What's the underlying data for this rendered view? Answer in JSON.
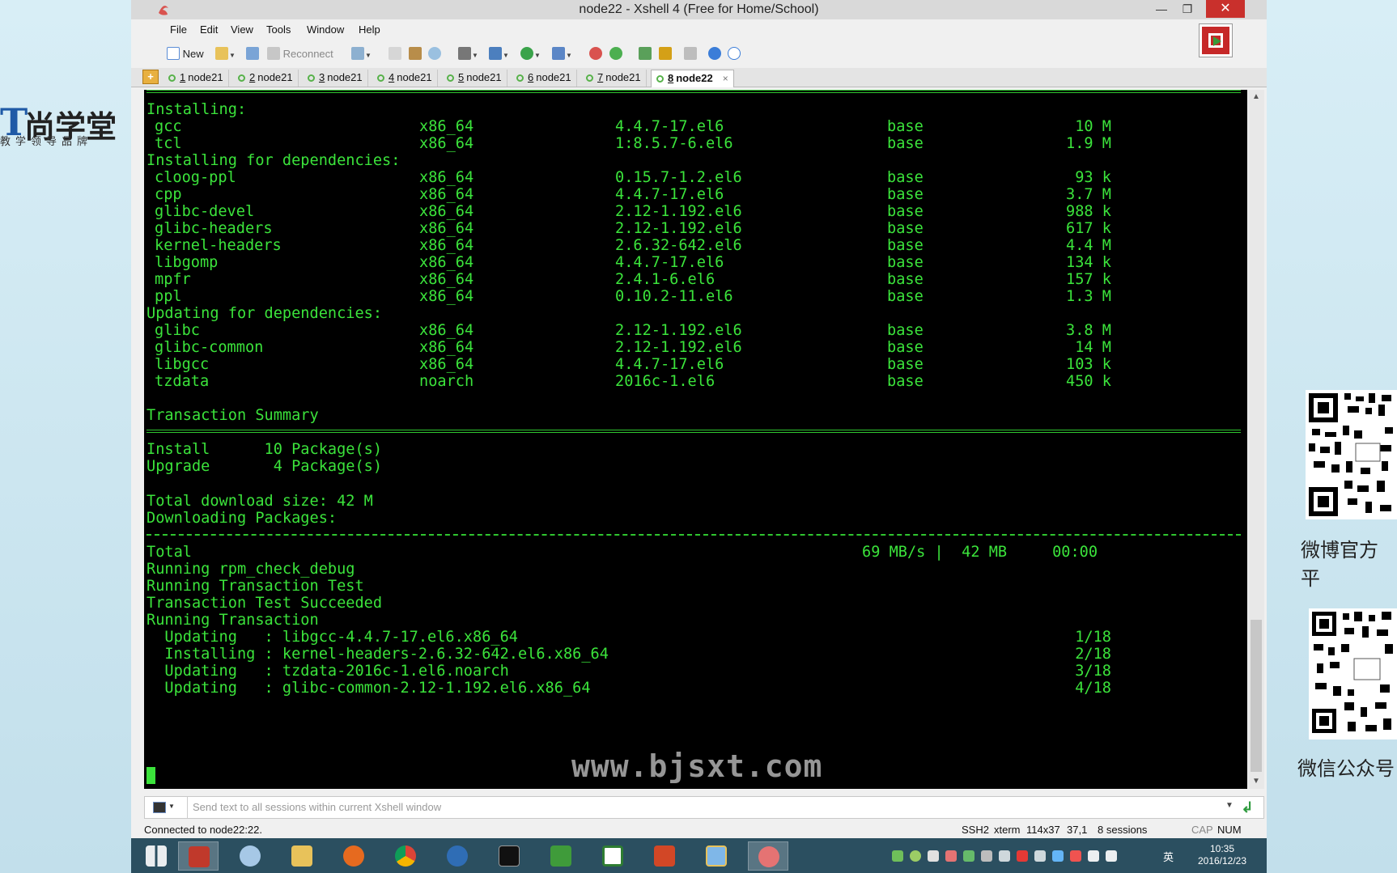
{
  "branding": {
    "logo_name": "尚学堂",
    "logo_slogan": "教学领导品牌",
    "qr_labels": [
      "微博官方平",
      "微信公众号"
    ],
    "watermark": "www.bjsxt.com"
  },
  "window": {
    "title": "node22 - Xshell 4 (Free for Home/School)",
    "controls": {
      "minimize": "—",
      "restore": "❐",
      "close": "✕"
    }
  },
  "menu": [
    "File",
    "Edit",
    "View",
    "Tools",
    "Window",
    "Help"
  ],
  "toolbar": {
    "new_label": "New",
    "reconnect_label": "Reconnect",
    "icons": [
      "new-session-icon",
      "open-folder-icon",
      "link-icon",
      "reconnect-icon",
      "properties-icon",
      "copy-icon",
      "paste-icon",
      "find-icon",
      "print-icon",
      "transfer-icon",
      "globe-icon",
      "keyboard-icon",
      "xftp-icon",
      "xmanager-icon",
      "layout-icon",
      "lock-icon",
      "compose-icon",
      "help-icon",
      "chat-icon"
    ]
  },
  "tabs": [
    {
      "num": "1",
      "label": "node21",
      "active": false
    },
    {
      "num": "2",
      "label": "node21",
      "active": false
    },
    {
      "num": "3",
      "label": "node21",
      "active": false
    },
    {
      "num": "4",
      "label": "node21",
      "active": false
    },
    {
      "num": "5",
      "label": "node21",
      "active": false
    },
    {
      "num": "6",
      "label": "node21",
      "active": false
    },
    {
      "num": "7",
      "label": "node21",
      "active": false
    },
    {
      "num": "8",
      "label": "node22",
      "active": true
    }
  ],
  "tab_add": "+",
  "tab_close": "×",
  "terminal": {
    "headings": {
      "installing": "Installing:",
      "installing_deps": "Installing for dependencies:",
      "updating_deps": "Updating for dependencies:",
      "summary": "Transaction Summary"
    },
    "installing": [
      {
        "pkg": "gcc",
        "arch": "x86_64",
        "version": "4.4.7-17.el6",
        "repo": "base",
        "size": "10 M"
      },
      {
        "pkg": "tcl",
        "arch": "x86_64",
        "version": "1:8.5.7-6.el6",
        "repo": "base",
        "size": "1.9 M"
      }
    ],
    "installing_deps": [
      {
        "pkg": "cloog-ppl",
        "arch": "x86_64",
        "version": "0.15.7-1.2.el6",
        "repo": "base",
        "size": "93 k"
      },
      {
        "pkg": "cpp",
        "arch": "x86_64",
        "version": "4.4.7-17.el6",
        "repo": "base",
        "size": "3.7 M"
      },
      {
        "pkg": "glibc-devel",
        "arch": "x86_64",
        "version": "2.12-1.192.el6",
        "repo": "base",
        "size": "988 k"
      },
      {
        "pkg": "glibc-headers",
        "arch": "x86_64",
        "version": "2.12-1.192.el6",
        "repo": "base",
        "size": "617 k"
      },
      {
        "pkg": "kernel-headers",
        "arch": "x86_64",
        "version": "2.6.32-642.el6",
        "repo": "base",
        "size": "4.4 M"
      },
      {
        "pkg": "libgomp",
        "arch": "x86_64",
        "version": "4.4.7-17.el6",
        "repo": "base",
        "size": "134 k"
      },
      {
        "pkg": "mpfr",
        "arch": "x86_64",
        "version": "2.4.1-6.el6",
        "repo": "base",
        "size": "157 k"
      },
      {
        "pkg": "ppl",
        "arch": "x86_64",
        "version": "0.10.2-11.el6",
        "repo": "base",
        "size": "1.3 M"
      }
    ],
    "updating_deps": [
      {
        "pkg": "glibc",
        "arch": "x86_64",
        "version": "2.12-1.192.el6",
        "repo": "base",
        "size": "3.8 M"
      },
      {
        "pkg": "glibc-common",
        "arch": "x86_64",
        "version": "2.12-1.192.el6",
        "repo": "base",
        "size": "14 M"
      },
      {
        "pkg": "libgcc",
        "arch": "x86_64",
        "version": "4.4.7-17.el6",
        "repo": "base",
        "size": "103 k"
      },
      {
        "pkg": "tzdata",
        "arch": "noarch",
        "version": "2016c-1.el6",
        "repo": "base",
        "size": "450 k"
      }
    ],
    "summary_install": "Install      10 Package(s)",
    "summary_upgrade": "Upgrade       4 Package(s)",
    "total_download": "Total download size: 42 M",
    "downloading": "Downloading Packages:",
    "total_label": "Total",
    "total_stats": "69 MB/s |  42 MB     00:00",
    "steps": [
      "Running rpm_check_debug",
      "Running Transaction Test",
      "Transaction Test Succeeded",
      "Running Transaction"
    ],
    "progress": [
      {
        "action": "  Updating   : libgcc-4.4.7-17.el6.x86_64",
        "count": "1/18"
      },
      {
        "action": "  Installing : kernel-headers-2.6.32-642.el6.x86_64",
        "count": "2/18"
      },
      {
        "action": "  Updating   : tzdata-2016c-1.el6.noarch",
        "count": "3/18"
      },
      {
        "action": "  Updating   : glibc-common-2.12-1.192.el6.x86_64",
        "count": "4/18"
      }
    ]
  },
  "sendbar": {
    "placeholder": "Send text to all sessions within current Xshell window"
  },
  "status": {
    "connection": "Connected to node22:22.",
    "protocol": "SSH2",
    "term": "xterm",
    "size": "114x37",
    "cursor": "37,1",
    "sessions": "8 sessions",
    "caps": "CAP",
    "num": "NUM"
  },
  "taskbar": {
    "apps": [
      "windows-start-icon",
      "presentation-app-icon",
      "paint-app-icon",
      "file-explorer-icon",
      "firefox-icon",
      "chrome-icon",
      "r-app-icon",
      "terminal-app-icon",
      "camtasia-icon",
      "camtasia-editor-icon",
      "powerpoint-icon",
      "notepad-app-icon",
      "xshell-app-icon"
    ],
    "ime": "英",
    "time": "10:35",
    "date": "2016/12/23"
  },
  "colors": {
    "terminal_fg": "#3be33b",
    "terminal_bg": "#000000",
    "close_red": "#c9302c",
    "taskbar": "#2b4f60"
  }
}
